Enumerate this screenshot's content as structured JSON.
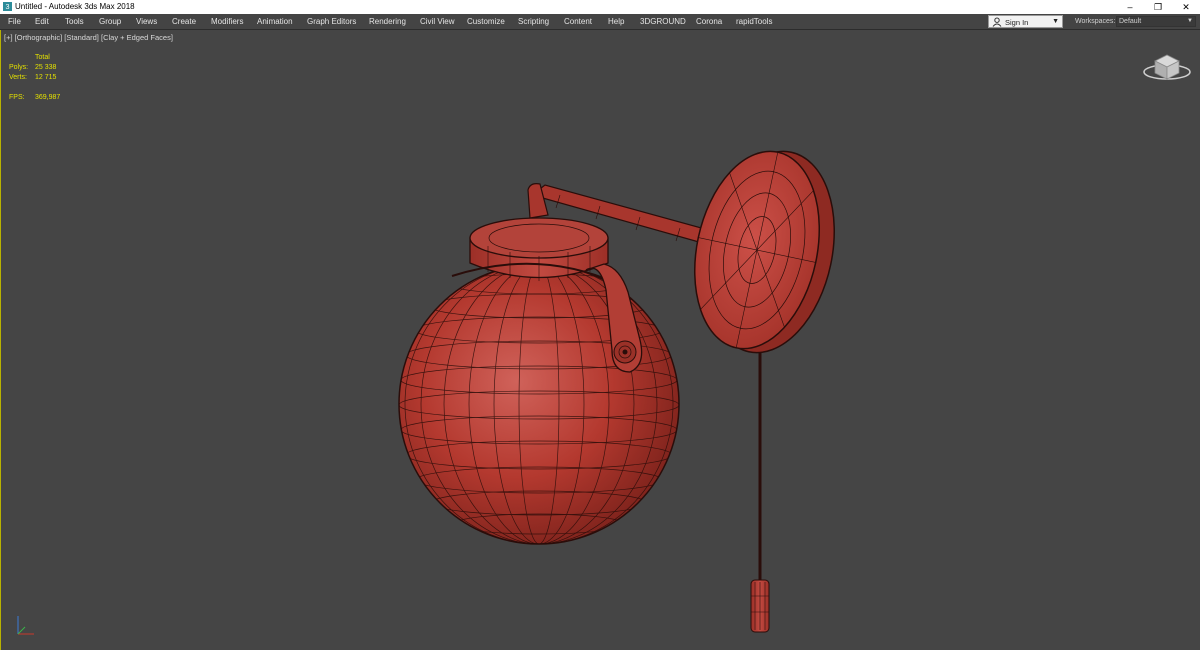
{
  "window": {
    "title": "Untitled - Autodesk 3ds Max 2018",
    "app_icon": "3ds-max-icon",
    "controls": {
      "minimize": "–",
      "restore": "❐",
      "close": "✕"
    }
  },
  "menu": [
    "File",
    "Edit",
    "Tools",
    "Group",
    "Views",
    "Create",
    "Modifiers",
    "Animation",
    "Graph Editors",
    "Rendering",
    "Civil View",
    "Customize",
    "Scripting",
    "Content",
    "Help",
    "3DGROUND",
    "Corona",
    "rapidTools"
  ],
  "account": {
    "sign_in": "Sign In",
    "icon": "user-icon"
  },
  "workspaces": {
    "label": "Workspaces:",
    "value": "Default"
  },
  "viewport": {
    "labels": [
      "[+]",
      "[Orthographic]",
      "[Standard]",
      "[Clay + Edged Faces]"
    ],
    "stats": {
      "total_label": "Total",
      "polys_label": "Polys:",
      "polys_value": "25 338",
      "verts_label": "Verts:",
      "verts_value": "12 715",
      "fps_label": "FPS:",
      "fps_value": "369,987"
    }
  },
  "colors": {
    "viewport_bg": "#454545",
    "model_fill": "#b4392f",
    "wire": "#2a0d0a",
    "stats_text": "#e4e100",
    "menubar_bg": "#444444"
  }
}
